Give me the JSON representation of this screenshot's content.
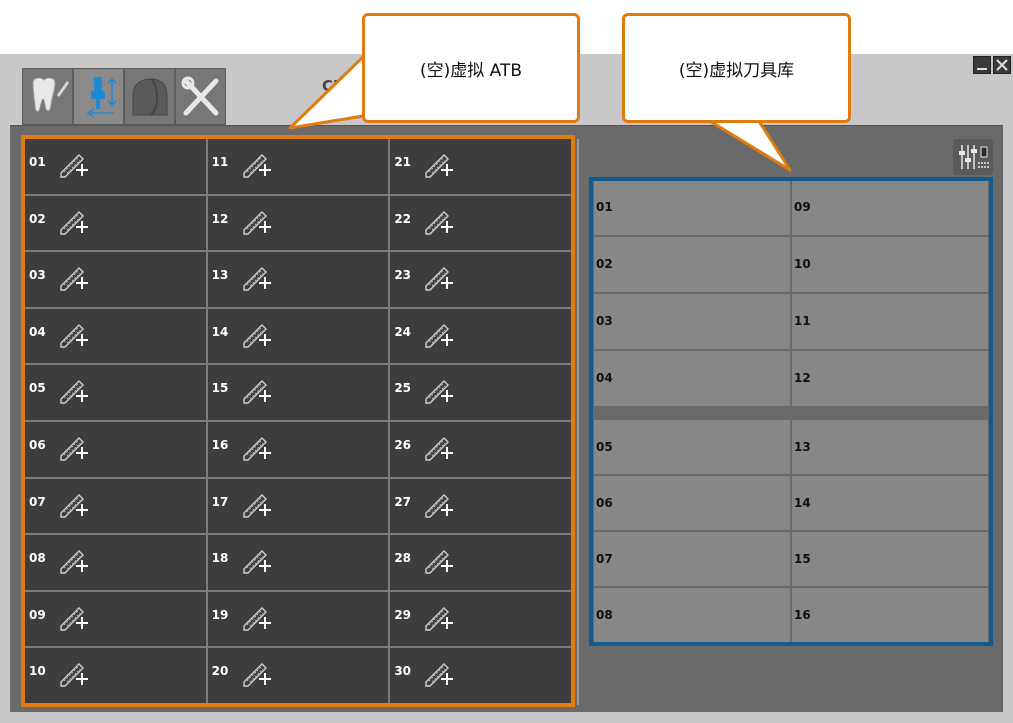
{
  "window": {
    "title_partial": "CNC",
    "minimize_icon": "minimize-icon",
    "close_icon": "close-icon"
  },
  "toolbar": {
    "tabs": [
      {
        "name": "tooth-tab",
        "icon": "tooth-pencil-icon"
      },
      {
        "name": "tool-position-tab",
        "icon": "spindle-tool-icon",
        "active": true
      },
      {
        "name": "stock-tab",
        "icon": "blank-stock-icon"
      },
      {
        "name": "tools-tab",
        "icon": "wrench-screwdriver-icon"
      }
    ]
  },
  "annotations": {
    "atb_label": "(空)虚拟 ATB",
    "library_label": "(空)虚拟刀具库"
  },
  "atb": {
    "slots": [
      "01",
      "02",
      "03",
      "04",
      "05",
      "06",
      "07",
      "08",
      "09",
      "10",
      "11",
      "12",
      "13",
      "14",
      "15",
      "16",
      "17",
      "18",
      "19",
      "20",
      "21",
      "22",
      "23",
      "24",
      "25",
      "26",
      "27",
      "28",
      "29",
      "30"
    ],
    "slot_icon": "add-tool-icon"
  },
  "library": {
    "settings_icon": "sliders-settings-icon",
    "group_a": [
      "01",
      "09",
      "02",
      "10",
      "03",
      "11",
      "04",
      "12"
    ],
    "group_b": [
      "05",
      "13",
      "06",
      "14",
      "07",
      "15",
      "08",
      "16"
    ]
  },
  "colors": {
    "atb_highlight": "#e07b10",
    "library_highlight": "#0d5c8c",
    "atb_cell": "#3d3d3d",
    "library_cell": "#878787"
  }
}
